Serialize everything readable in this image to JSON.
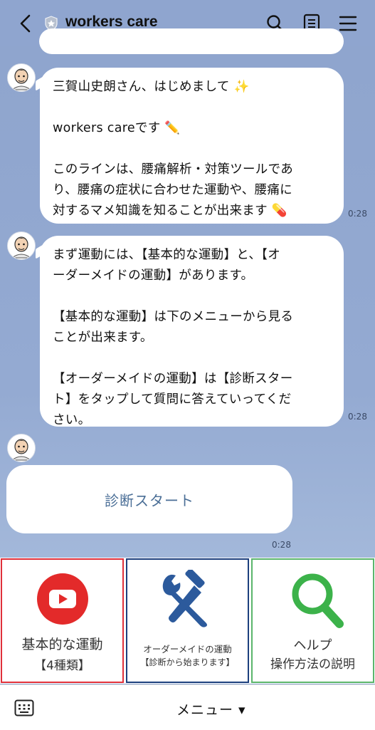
{
  "header": {
    "title": "workers care"
  },
  "messages": [
    {
      "lines": [
        "三賀山史朗さん、はじめまして ✨",
        "",
        "workers careです ✏️",
        "",
        "このラインは、腰痛解析・対策ツールであ",
        "り、腰痛の症状に合わせた運動や、腰痛に",
        "対するマメ知識を知ることが出来ます 💊"
      ],
      "time": "0:28"
    },
    {
      "lines": [
        "まず運動には、【基本的な運動】と、【オ",
        "ーダーメイドの運動】があります。",
        "",
        "【基本的な運動】は下のメニューから見る",
        "ことが出来ます。",
        "",
        "【オーダーメイドの運動】は【診断スター",
        "ト】をタップして質問に答えていってくだ",
        "さい。"
      ],
      "time": "0:28"
    }
  ],
  "start_card": {
    "label": "診断スタート",
    "time": "0:28"
  },
  "rich_menu": {
    "basic": {
      "line1": "基本的な運動",
      "line2": "【4種類】",
      "icon": "youtube-play-icon",
      "color": "#e0303a"
    },
    "custom": {
      "line1": "オーダーメイドの運動",
      "line2": "【診断から始まります】",
      "icon": "tools-icon",
      "color": "#1c3f7d"
    },
    "help": {
      "line1": "ヘルプ",
      "line2": "操作方法の説明",
      "icon": "magnifier-icon",
      "color": "#5bb56b"
    }
  },
  "bottom_bar": {
    "menu_label": "メニュー ▾"
  }
}
